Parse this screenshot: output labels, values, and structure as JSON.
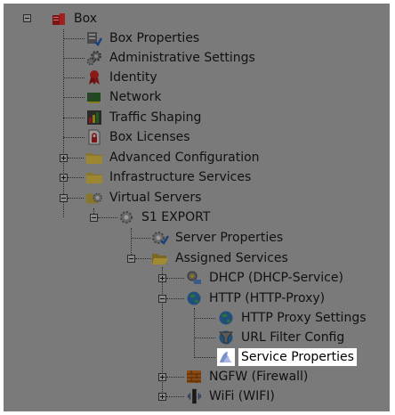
{
  "tree": {
    "box": {
      "label": "Box",
      "icon": "box-icon"
    },
    "box_properties": {
      "label": "Box Properties",
      "icon": "box-properties-icon"
    },
    "administrative_settings": {
      "label": "Administrative Settings",
      "icon": "gear-icon"
    },
    "identity": {
      "label": "Identity",
      "icon": "ribbon-icon"
    },
    "network": {
      "label": "Network",
      "icon": "network-card-icon"
    },
    "traffic_shaping": {
      "label": "Traffic Shaping",
      "icon": "traffic-shaping-icon"
    },
    "box_licenses": {
      "label": "Box Licenses",
      "icon": "license-icon"
    },
    "advanced_configuration": {
      "label": "Advanced Configuration",
      "icon": "folder-icon"
    },
    "infrastructure_services": {
      "label": "Infrastructure Services",
      "icon": "folder-icon"
    },
    "virtual_servers": {
      "label": "Virtual Servers",
      "icon": "folder-gear-icon"
    },
    "s1_export": {
      "label": "S1 EXPORT",
      "icon": "server-gear-icon"
    },
    "server_properties": {
      "label": "Server Properties",
      "icon": "server-properties-icon"
    },
    "assigned_services": {
      "label": "Assigned Services",
      "icon": "open-folder-icon"
    },
    "dhcp": {
      "label": "DHCP (DHCP-Service)",
      "icon": "dhcp-icon"
    },
    "http": {
      "label": "HTTP (HTTP-Proxy)",
      "icon": "globe-icon"
    },
    "http_proxy_settings": {
      "label": "HTTP Proxy Settings",
      "icon": "globe-icon"
    },
    "url_filter_config": {
      "label": "URL Filter Config",
      "icon": "url-filter-icon"
    },
    "service_properties": {
      "label": "Service Properties",
      "icon": "service-properties-icon"
    },
    "ngfw": {
      "label": "NGFW (Firewall)",
      "icon": "firewall-icon"
    },
    "wifi": {
      "label": "WiFi (WIFI)",
      "icon": "wifi-icon"
    }
  },
  "colors": {
    "background": "#7a7a7a",
    "selected": "#ffffff"
  }
}
